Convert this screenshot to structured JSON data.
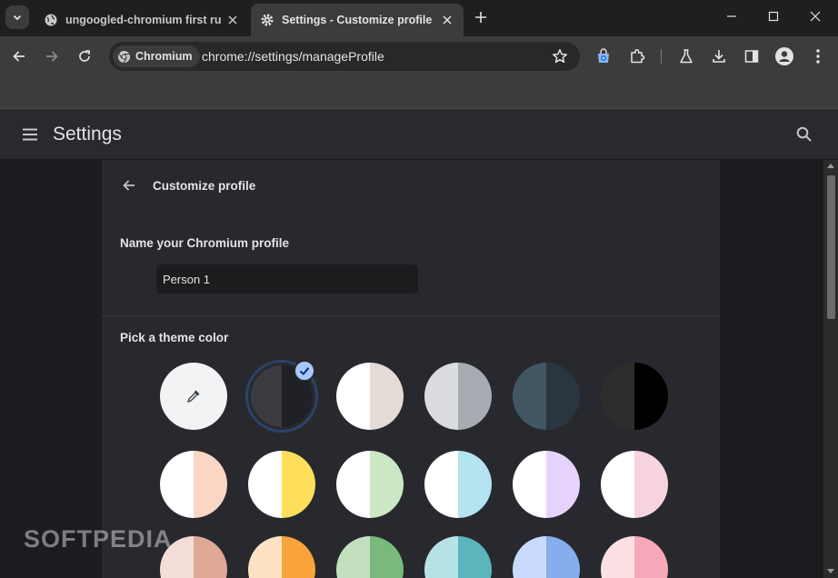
{
  "tabs": [
    {
      "title": "ungoogled-chromium first run",
      "icon": "globe-icon"
    },
    {
      "title": "Settings - Customize profile",
      "icon": "gear-icon"
    }
  ],
  "omnibox": {
    "chip": "Chromium",
    "url": "chrome://settings/manageProfile"
  },
  "settings": {
    "title": "Settings"
  },
  "subpage": {
    "title": "Customize profile"
  },
  "name_section": {
    "label": "Name your Chromium profile",
    "value": "Person 1"
  },
  "theme_section": {
    "label": "Pick a theme color"
  },
  "theme_colors": [
    [
      [
        "#f1f3f4",
        "#f1f3f4"
      ],
      [
        "#3a3b40",
        "#202124"
      ],
      [
        "#ffffff",
        "#e4dad6"
      ],
      [
        "#dadce0",
        "#a9abb3"
      ],
      [
        "#425663",
        "#2b3540"
      ],
      [
        "#2d2d2d",
        "#000000"
      ]
    ],
    [
      [
        "#ffffff",
        "#fcd6c4"
      ],
      [
        "#ffffff",
        "#fedf5a"
      ],
      [
        "#ffffff",
        "#cbe7c3"
      ],
      [
        "#ffffff",
        "#b3e4ef"
      ],
      [
        "#ffffff",
        "#e6d3fd"
      ],
      [
        "#ffffff",
        "#f7d3e0"
      ]
    ],
    [
      [
        "#f3ddd6",
        "#e0a896"
      ],
      [
        "#fde3c4",
        "#f9a43a"
      ],
      [
        "#c3dfc0",
        "#79ba7c"
      ],
      [
        "#b6e2e5",
        "#5bb5bd"
      ],
      [
        "#c9dafd",
        "#86aeef"
      ],
      [
        "#fde0e4",
        "#f7a8b8"
      ]
    ]
  ],
  "selected_theme": "dark-gray",
  "watermark": "SOFTPEDIA"
}
